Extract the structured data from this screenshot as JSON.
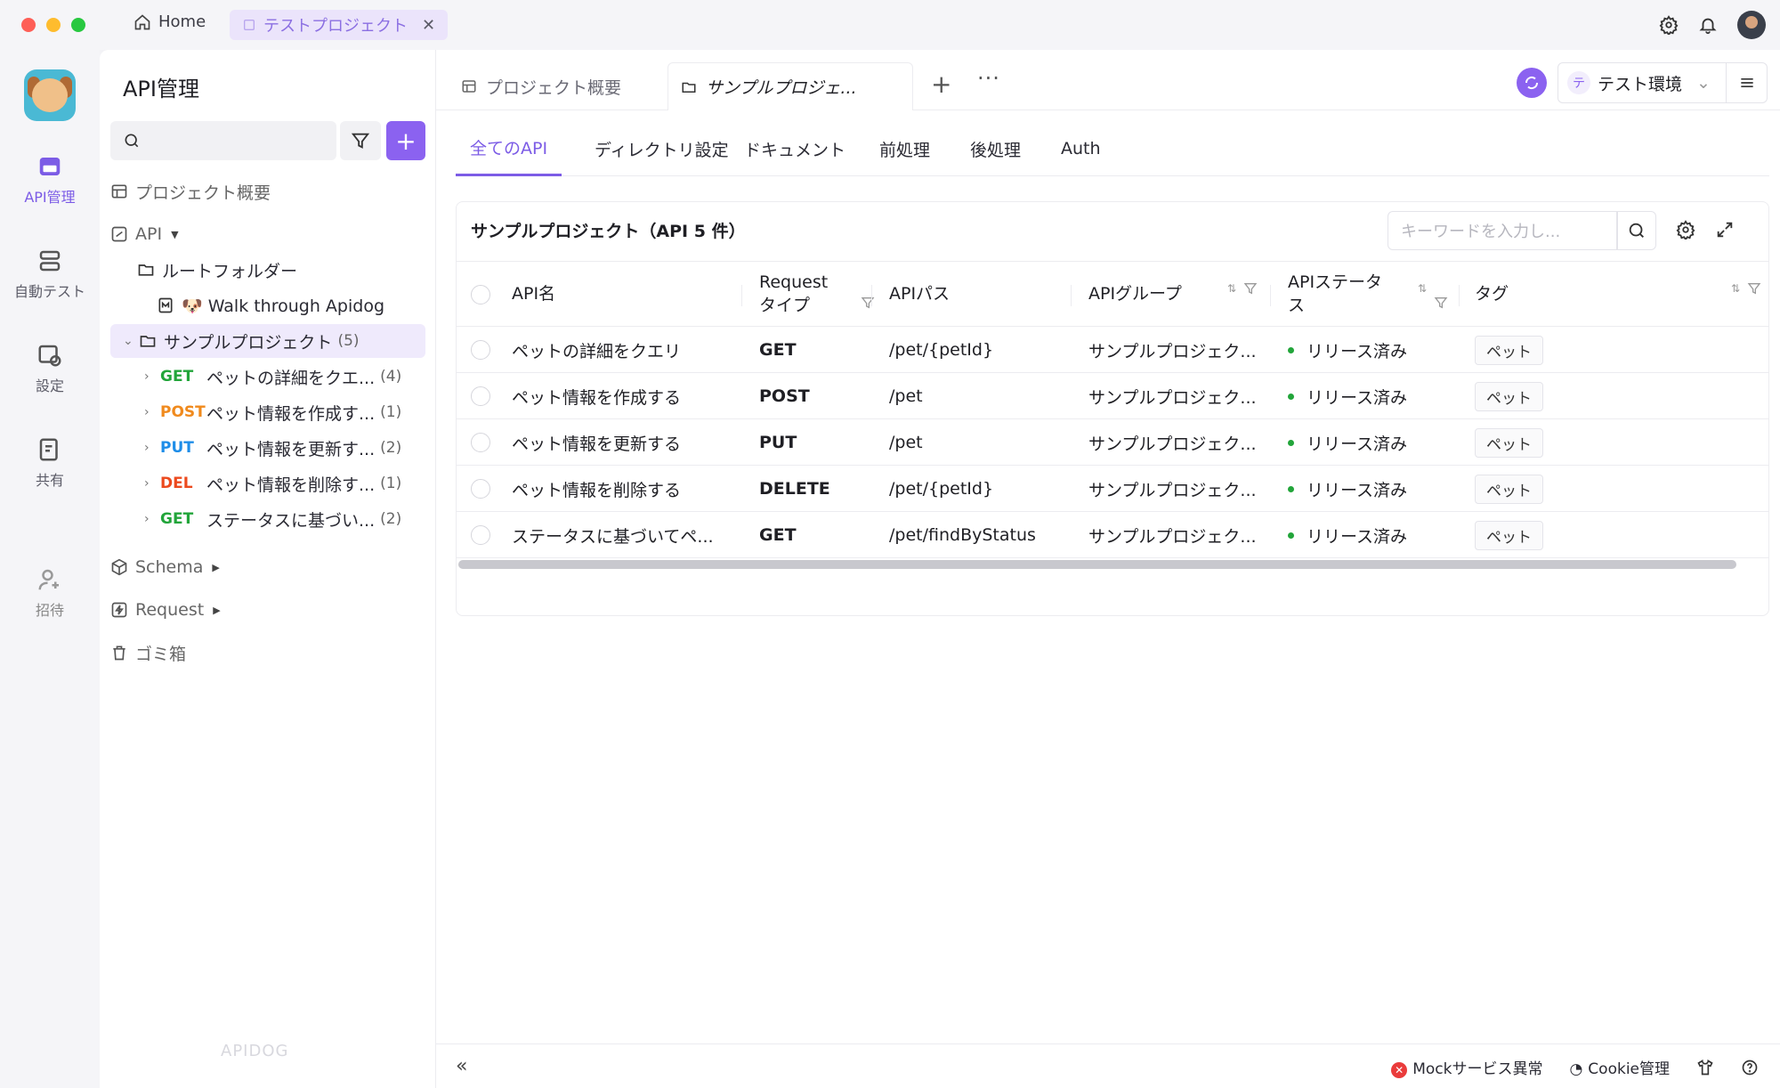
{
  "window": {
    "home_tab": "Home",
    "active_tab": "テストプロジェクト"
  },
  "rail": {
    "items": [
      {
        "label": "API管理",
        "icon": "api-management-icon"
      },
      {
        "label": "自動テスト",
        "icon": "auto-test-icon"
      },
      {
        "label": "設定",
        "icon": "settings-icon"
      },
      {
        "label": "共有",
        "icon": "share-icon"
      },
      {
        "label": "招待",
        "icon": "invite-icon"
      }
    ]
  },
  "sidebar": {
    "title": "API管理",
    "overview": "プロジェクト概要",
    "api_label": "API",
    "root_folder": "ルートフォルダー",
    "walk_through": "🐶 Walk through Apidog",
    "sample_project": {
      "label": "サンプルプロジェクト",
      "count": "(5)"
    },
    "endpoints": [
      {
        "method": "GET",
        "label": "ペットの詳細をクエ...",
        "count": "(4)"
      },
      {
        "method": "POST",
        "label": "ペット情報を作成す...",
        "count": "(1)"
      },
      {
        "method": "PUT",
        "label": "ペット情報を更新す...",
        "count": "(2)"
      },
      {
        "method": "DEL",
        "label": "ペット情報を削除す...",
        "count": "(1)"
      },
      {
        "method": "GET",
        "label": "ステータスに基づい...",
        "count": "(2)"
      }
    ],
    "schema": "Schema",
    "request": "Request",
    "trash": "ゴミ箱",
    "watermark": "APIDOG"
  },
  "main": {
    "tabs": {
      "overview": "プロジェクト概要",
      "sample": "サンプルプロジェ..."
    },
    "environment": {
      "badge": "テ",
      "label": "テスト環境"
    },
    "subtabs": [
      "全てのAPI",
      "ディレクトリ設定",
      "ドキュメント",
      "前処理",
      "後処理",
      "Auth"
    ],
    "card": {
      "title": "サンプルプロジェクト（API 5 件）",
      "search_placeholder": "キーワードを入力し..."
    },
    "table": {
      "headers": {
        "name": "API名",
        "request_type": "Request\nタイプ",
        "path": "APIパス",
        "group": "APIグループ",
        "status": "APIステータ\nス",
        "tag": "タグ"
      },
      "rows": [
        {
          "name": "ペットの詳細をクエリ",
          "method": "GET",
          "path": "/pet/{petId}",
          "group": "サンプルプロジェク...",
          "status": "リリース済み",
          "tag": "ペット"
        },
        {
          "name": "ペット情報を作成する",
          "method": "POST",
          "path": "/pet",
          "group": "サンプルプロジェク...",
          "status": "リリース済み",
          "tag": "ペット"
        },
        {
          "name": "ペット情報を更新する",
          "method": "PUT",
          "path": "/pet",
          "group": "サンプルプロジェク...",
          "status": "リリース済み",
          "tag": "ペット"
        },
        {
          "name": "ペット情報を削除する",
          "method": "DELETE",
          "path": "/pet/{petId}",
          "group": "サンプルプロジェク...",
          "status": "リリース済み",
          "tag": "ペット"
        },
        {
          "name": "ステータスに基づいてペ...",
          "method": "GET",
          "path": "/pet/findByStatus",
          "group": "サンプルプロジェク...",
          "status": "リリース済み",
          "tag": "ペット"
        }
      ]
    }
  },
  "statusbar": {
    "mock": "Mockサービス異常",
    "cookie": "Cookie管理"
  },
  "colors": {
    "accent": "#8b62f0",
    "get": "#22a53a",
    "post": "#f08a1d",
    "put": "#1e8de8",
    "delete": "#ec4a1e"
  }
}
